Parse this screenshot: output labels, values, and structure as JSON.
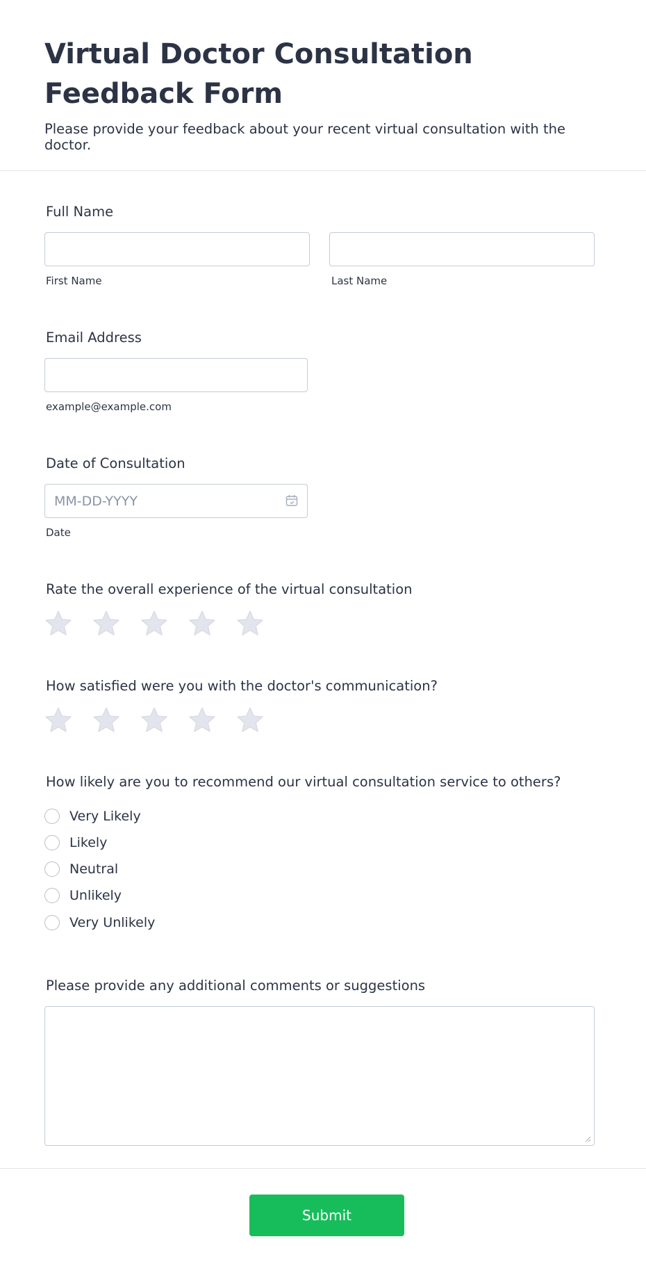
{
  "form": {
    "title": "Virtual Doctor Consultation Feedback Form",
    "subtitle": "Please provide your feedback about your recent virtual consultation with the doctor."
  },
  "full_name": {
    "label": "Full Name",
    "first_value": "",
    "last_value": "",
    "first_sublabel": "First Name",
    "last_sublabel": "Last Name"
  },
  "email": {
    "label": "Email Address",
    "value": "",
    "sublabel": "example@example.com"
  },
  "date": {
    "label": "Date of Consultation",
    "placeholder": "MM-DD-YYYY",
    "sublabel": "Date",
    "icon": "calendar-icon"
  },
  "rating_overall": {
    "label": "Rate the overall experience of the virtual consultation",
    "max_stars": 5,
    "selected": 0
  },
  "rating_communication": {
    "label": "How satisfied were you with the doctor's communication?",
    "max_stars": 5,
    "selected": 0
  },
  "recommend": {
    "label": "How likely are you to recommend our virtual consultation service to others?",
    "options": [
      "Very Likely",
      "Likely",
      "Neutral",
      "Unlikely",
      "Very Unlikely"
    ]
  },
  "comments": {
    "label": "Please provide any additional comments or suggestions",
    "value": ""
  },
  "submit_label": "Submit",
  "colors": {
    "accent": "#18bd5b",
    "star": "#e3e5ee",
    "text": "#2c3345"
  }
}
